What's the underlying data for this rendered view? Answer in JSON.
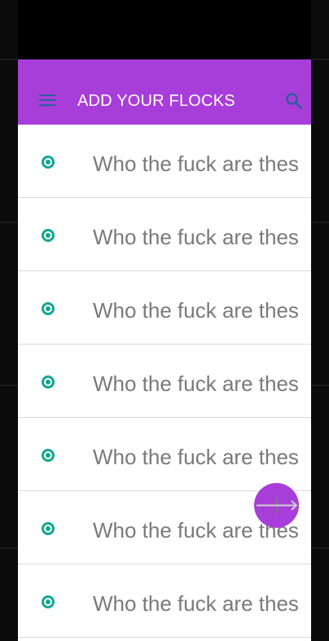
{
  "appbar": {
    "title": "ADD YOUR FLOCKS",
    "menu_icon": "hamburger-menu-icon",
    "search_icon": "search-icon",
    "color": "#a83ed9"
  },
  "list": {
    "items": [
      {
        "label": "Who the fuck are thes"
      },
      {
        "label": "Who the fuck are thes"
      },
      {
        "label": "Who the fuck are thes"
      },
      {
        "label": "Who the fuck are thes"
      },
      {
        "label": "Who the fuck are thes"
      },
      {
        "label": "Who the fuck are thes"
      },
      {
        "label": "Who the fuck are thes"
      }
    ],
    "radio_color": "#12a690"
  },
  "fab": {
    "icon": "plus-icon"
  }
}
